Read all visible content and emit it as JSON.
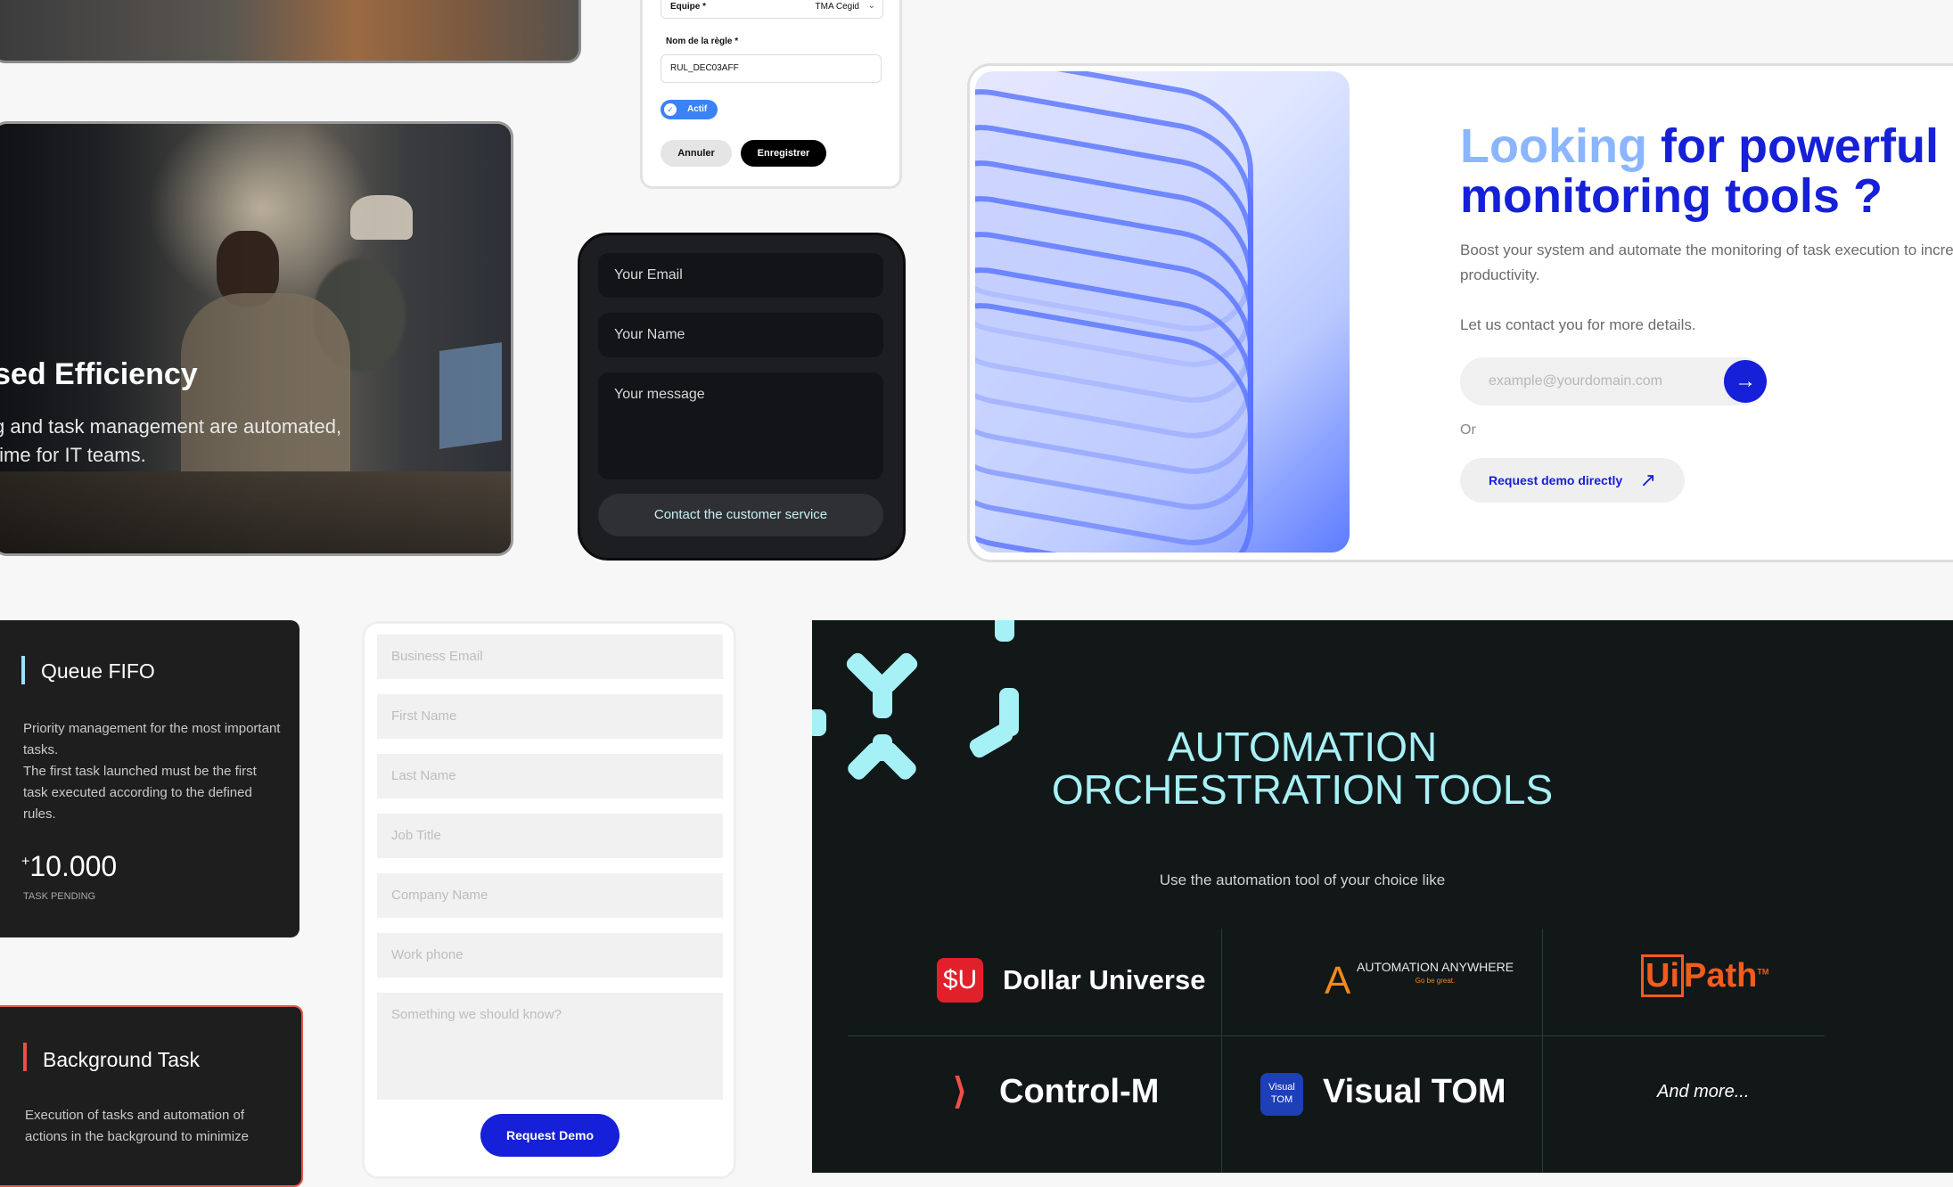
{
  "photo_card": {
    "title": "sed Efficiency",
    "subtitle": "g and task management are automated, time for IT teams."
  },
  "rule_form": {
    "team_label": "Equipe *",
    "team_value": "TMA Cegid",
    "rule_label": "Nom de la règle *",
    "rule_value": "RUL_DEC03AFF",
    "toggle_label": "Actif",
    "cancel_label": "Annuler",
    "save_label": "Enregistrer"
  },
  "contact_form": {
    "email_placeholder": "Your Email",
    "name_placeholder": "Your Name",
    "message_placeholder": "Your message",
    "submit_label": "Contact the customer service"
  },
  "monitoring": {
    "title_light": "Looking",
    "title_dark_1": " for powerful",
    "title_dark_2": "monitoring tools ?",
    "paragraph": "Boost your system and automate the monitoring of task execution to increase productivity.",
    "paragraph_line1": "Boost your system and automate the monitoring of task execution to increa",
    "paragraph_line2": "productivity.",
    "contact_line": "Let us contact you for more details.",
    "email_placeholder": "example@yourdomain.com",
    "or_label": "Or",
    "demo_label": "Request demo directly",
    "accent": "#1620d8"
  },
  "features": [
    {
      "title": "Queue FIFO",
      "description": "Priority management for the most important tasks.\nThe first task launched must be the first task executed according to the defined rules.",
      "count_prefix": "+",
      "count": "10.000",
      "caption": "TASK PENDING"
    },
    {
      "title": "Background Task",
      "description": "Execution of tasks and automation of actions in the background to minimize"
    }
  ],
  "lead_form": {
    "fields": [
      "Business Email",
      "First Name",
      "Last Name",
      "Job Title",
      "Company Name",
      "Work phone",
      "Something we should know?"
    ],
    "submit_label": "Request Demo"
  },
  "automation": {
    "title_line1": "AUTOMATION",
    "title_line2": "ORCHESTRATION TOOLS",
    "subtitle": "Use the automation tool of your choice like",
    "tools": [
      "Dollar Universe",
      "AUTOMATION ANYWHERE",
      "UiPath",
      "Control-M",
      "Visual TOM",
      "And more..."
    ],
    "automation_anywhere_tagline": "Go be great.",
    "accent": "#a6f1f6"
  }
}
